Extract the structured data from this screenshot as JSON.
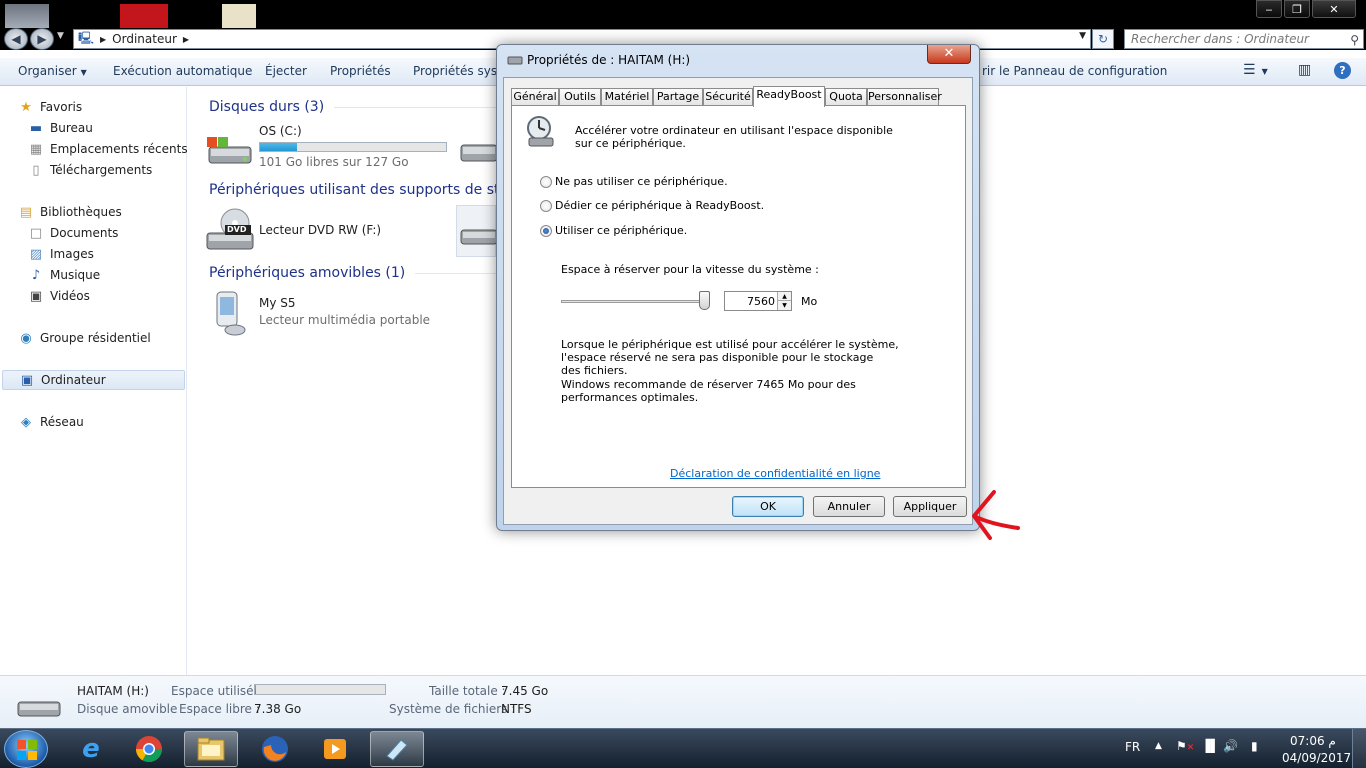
{
  "window": {
    "address": {
      "path_segment": "Ordinateur",
      "search_placeholder": "Rechercher dans : Ordinateur"
    }
  },
  "toolbar": {
    "items": [
      "Organiser",
      "Exécution automatique",
      "Éjecter",
      "Propriétés",
      "Propriétés systè",
      "rir le Panneau de configuration"
    ]
  },
  "navpane": {
    "favoris": "Favoris",
    "bureau": "Bureau",
    "emplacements": "Emplacements récents",
    "telechargements": "Téléchargements",
    "bibliotheques": "Bibliothèques",
    "documents": "Documents",
    "images": "Images",
    "musique": "Musique",
    "videos": "Vidéos",
    "groupe": "Groupe résidentiel",
    "ordinateur": "Ordinateur",
    "reseau": "Réseau"
  },
  "content": {
    "groups": {
      "hard": "Disques durs (3)",
      "storage": "Périphériques utilisant des supports de stoc",
      "removable": "Périphériques amovibles (1)"
    },
    "drive_c": {
      "name": "OS (C:)",
      "free": "101 Go libres sur 127 Go",
      "used_fraction": 0.2
    },
    "dvd": {
      "name": "Lecteur DVD RW (F:)",
      "badge": "DVD"
    },
    "phone": {
      "name": "My S5",
      "sub": "Lecteur multimédia portable"
    }
  },
  "details": {
    "name": "HAITAM (H:)",
    "type": "Disque amovible",
    "used_label": "Espace utilisé :",
    "free_label": "Espace libre :",
    "free_value": "7.38 Go",
    "total_label": "Taille totale :",
    "total_value": "7.45 Go",
    "fs_label": "Système de fichiers :",
    "fs_value": "NTFS",
    "used_fraction": 0.01
  },
  "dialog": {
    "title": "Propriétés de : HAITAM (H:)",
    "tabs": [
      "Général",
      "Outils",
      "Matériel",
      "Partage",
      "Sécurité",
      "ReadyBoost",
      "Quota",
      "Personnaliser"
    ],
    "selected_tab": "ReadyBoost",
    "intro": [
      "Accélérer votre ordinateur en utilisant l'espace disponible",
      "sur ce périphérique."
    ],
    "options": [
      "Ne pas utiliser ce périphérique.",
      "Dédier ce périphérique à ReadyBoost.",
      "Utiliser ce périphérique."
    ],
    "selected_option": 2,
    "space_label": "Espace à réserver pour la vitesse du système :",
    "space_value": "7560",
    "space_unit": "Mo",
    "slider_fraction": 1.0,
    "notes": [
      "Lorsque le périphérique est utilisé pour accélérer le système,",
      "l'espace réservé ne sera pas disponible pour le stockage",
      "des fichiers.",
      "Windows recommande de réserver 7465 Mo pour des",
      "performances optimales."
    ],
    "privacy_link": "Déclaration de confidentialité en ligne",
    "buttons": {
      "ok": "OK",
      "cancel": "Annuler",
      "apply": "Appliquer"
    }
  },
  "taskbar": {
    "lang": "FR",
    "time": "07:06 م",
    "date": "04/09/2017"
  },
  "colors": {
    "annotation_arrow": "#e0141e",
    "group_header": "#1e3287",
    "accent": "#2398d3"
  }
}
